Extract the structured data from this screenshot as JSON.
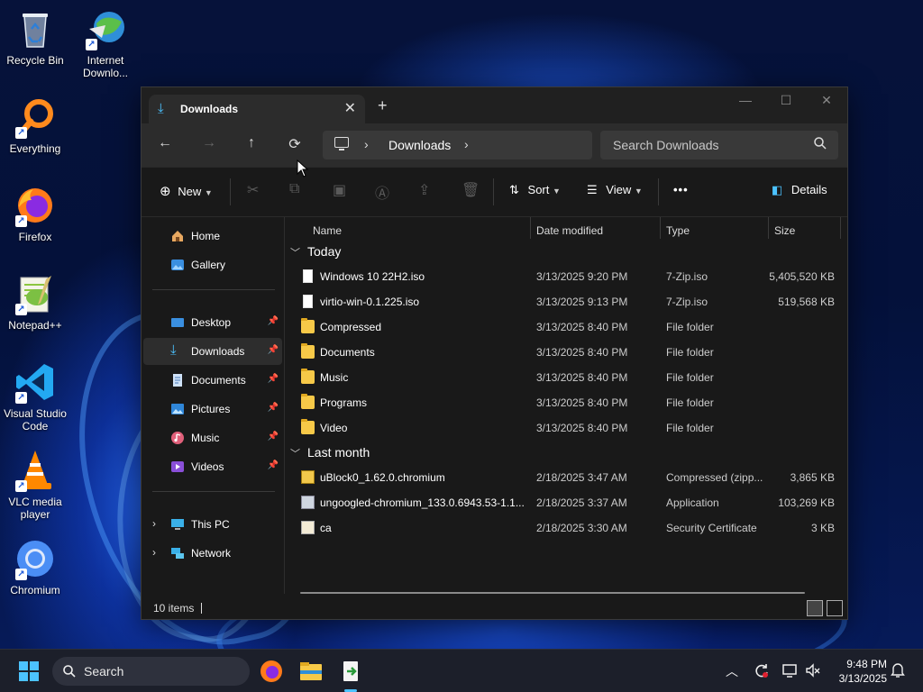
{
  "desktop": {
    "icons": [
      {
        "label": "Recycle Bin"
      },
      {
        "label": "Internet Downlo..."
      },
      {
        "label": "Everything"
      },
      {
        "label": "Firefox"
      },
      {
        "label": "Notepad++"
      },
      {
        "label": "Visual Studio Code"
      },
      {
        "label": "VLC media player"
      },
      {
        "label": "Chromium"
      }
    ]
  },
  "window": {
    "tab_title": "Downloads",
    "new_tab": "+",
    "controls": {
      "minimize": "—",
      "maximize": "☐",
      "close": "✕"
    },
    "nav": {
      "back": "←",
      "forward": "→",
      "up": "↑",
      "refresh": "⟳"
    },
    "address": {
      "crumb": "Downloads"
    },
    "search_placeholder": "Search Downloads",
    "toolbar": {
      "new_label": "New",
      "sort_label": "Sort",
      "view_label": "View",
      "more_label": "•••",
      "details_label": "Details"
    },
    "sidebar": {
      "items": [
        {
          "label": "Home"
        },
        {
          "label": "Gallery"
        },
        {
          "label": "Desktop"
        },
        {
          "label": "Downloads"
        },
        {
          "label": "Documents"
        },
        {
          "label": "Pictures"
        },
        {
          "label": "Music"
        },
        {
          "label": "Videos"
        },
        {
          "label": "This PC"
        },
        {
          "label": "Network"
        }
      ]
    },
    "columns": {
      "name": "Name",
      "date": "Date modified",
      "type": "Type",
      "size": "Size"
    },
    "groups": [
      {
        "label": "Today",
        "files": [
          {
            "name": "Windows 10 22H2.iso",
            "date": "3/13/2025 9:20 PM",
            "type": "7-Zip.iso",
            "size": "5,405,520 KB"
          },
          {
            "name": "virtio-win-0.1.225.iso",
            "date": "3/13/2025 9:13 PM",
            "type": "7-Zip.iso",
            "size": "519,568 KB"
          },
          {
            "name": "Compressed",
            "date": "3/13/2025 8:40 PM",
            "type": "File folder",
            "size": ""
          },
          {
            "name": "Documents",
            "date": "3/13/2025 8:40 PM",
            "type": "File folder",
            "size": ""
          },
          {
            "name": "Music",
            "date": "3/13/2025 8:40 PM",
            "type": "File folder",
            "size": ""
          },
          {
            "name": "Programs",
            "date": "3/13/2025 8:40 PM",
            "type": "File folder",
            "size": ""
          },
          {
            "name": "Video",
            "date": "3/13/2025 8:40 PM",
            "type": "File folder",
            "size": ""
          }
        ]
      },
      {
        "label": "Last month",
        "files": [
          {
            "name": "uBlock0_1.62.0.chromium",
            "date": "2/18/2025 3:47 AM",
            "type": "Compressed (zipp...",
            "size": "3,865 KB"
          },
          {
            "name": "ungoogled-chromium_133.0.6943.53-1.1...",
            "date": "2/18/2025 3:37 AM",
            "type": "Application",
            "size": "103,269 KB"
          },
          {
            "name": "ca",
            "date": "2/18/2025 3:30 AM",
            "type": "Security Certificate",
            "size": "3 KB"
          }
        ]
      }
    ],
    "status": {
      "count": "10 items"
    }
  },
  "taskbar": {
    "search_label": "Search",
    "clock_time": "9:48 PM",
    "clock_date": "3/13/2025"
  }
}
